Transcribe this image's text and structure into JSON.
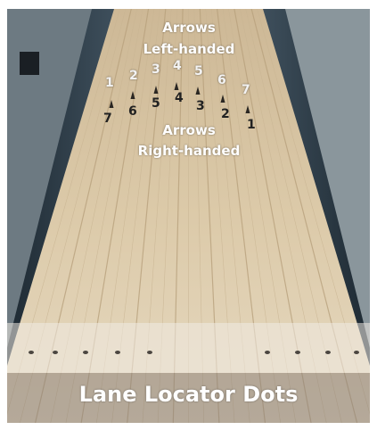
{
  "labels": {
    "arrows_left_line1": "Arrows",
    "arrows_left_line2": "Left-handed",
    "arrows_right_line1": "Arrows",
    "arrows_right_line2": "Right-handed",
    "caption": "Lane Locator Dots"
  },
  "arrow_numbers_left": [
    "1",
    "2",
    "3",
    "4",
    "5",
    "6",
    "7"
  ],
  "arrow_numbers_right": [
    "7",
    "6",
    "5",
    "4",
    "3",
    "2",
    "1"
  ],
  "colors": {
    "lane_wood": "#d9c7a9",
    "gutter": "#2c3a45",
    "caption_text": "#ffffff"
  }
}
